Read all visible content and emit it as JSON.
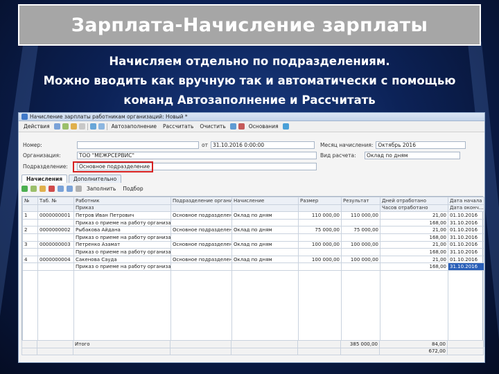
{
  "slide": {
    "title": "Зарплата-Начисление зарплаты",
    "subtitle_lines": [
      "Начисляем отдельно по подразделениям.",
      "Можно вводить как вручную так и автоматически с помощью",
      "команд Автозаполнение и Рассчитать"
    ]
  },
  "window": {
    "title": "Начисление зарплаты работникам организаций: Новый *",
    "toolbar": {
      "actions": "Действия",
      "autofill": "Автозаполнение",
      "calculate": "Рассчитать",
      "clear": "Очистить",
      "bases": "Основания"
    }
  },
  "form": {
    "number_label": "Номер:",
    "date_value": "31.10.2016 0:00:00",
    "month_label": "Месяц начисления:",
    "month_value": "Октябрь 2016",
    "org_label": "Организация:",
    "org_value": "ТОО \"МЕЖРСЕРВИС\"",
    "calc_type_label": "Вид расчета:",
    "calc_type_value": "Оклад по дням",
    "division_label": "Подразделение:",
    "division_value": "Основное подразделение"
  },
  "tabs": [
    "Начисления",
    "Дополнительно"
  ],
  "grid_toolbar": {
    "fill": "Заполнить",
    "select": "Подбор"
  },
  "table": {
    "headers_row1": [
      "№",
      "Таб. №",
      "Работник",
      "Подразделение организации",
      "Начисление",
      "Размер",
      "Результат",
      "Дней отработано",
      "Дата начала"
    ],
    "headers_row2": [
      "",
      "",
      "Приказ",
      "",
      "",
      "",
      "",
      "Часов отработано",
      "Дата оконч..."
    ],
    "rows": [
      {
        "n": "1",
        "tab": "0000000001",
        "worker": "Петров Иван Петрович",
        "order": "Приказ о приеме на работу организаций 0000...",
        "division": "Основное подразделение",
        "accrual": "Оклад по дням",
        "size": "110 000,00",
        "result": "110 000,00",
        "days": "21,00",
        "hours": "168,00",
        "start": "01.10.2016",
        "end": "31.10.2016"
      },
      {
        "n": "2",
        "tab": "0000000002",
        "worker": "Рыбакова Айдана",
        "order": "Приказ о приеме на работу организаций 0000...",
        "division": "Основное подразделение",
        "accrual": "Оклад по дням",
        "size": "75 000,00",
        "result": "75 000,00",
        "days": "21,00",
        "hours": "168,00",
        "start": "01.10.2016",
        "end": "31.10.2016"
      },
      {
        "n": "3",
        "tab": "0000000003",
        "worker": "Петренко Азамат",
        "order": "Приказ о приеме на работу организаций 0000...",
        "division": "Основное подразделение",
        "accrual": "Оклад по дням",
        "size": "100 000,00",
        "result": "100 000,00",
        "days": "21,00",
        "hours": "168,00",
        "start": "01.10.2016",
        "end": "31.10.2016"
      },
      {
        "n": "4",
        "tab": "0000000004",
        "worker": "Сакенова Сауда",
        "order": "Приказ о приеме на работу организаций 0000...",
        "division": "Основное подразделение",
        "accrual": "Оклад по дням",
        "size": "100 000,00",
        "result": "100 000,00",
        "days": "21,00",
        "hours": "168,00",
        "start": "01.10.2016",
        "end": "31.10.2016"
      }
    ],
    "totals": {
      "label": "Итого",
      "result": "385 000,00",
      "days": "84,00",
      "hours": "672,00"
    }
  }
}
